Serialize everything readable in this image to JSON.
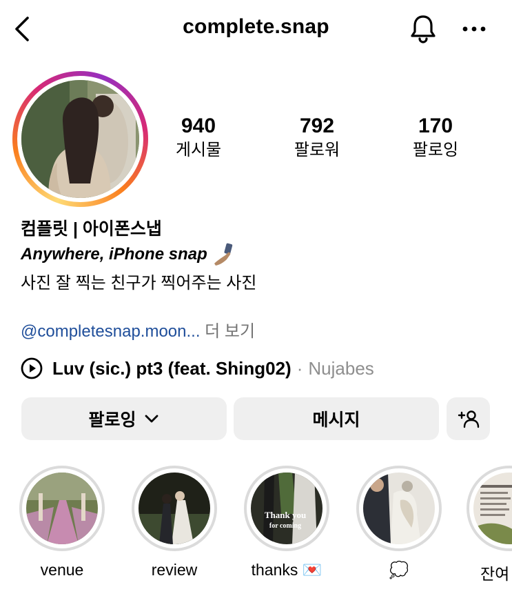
{
  "header": {
    "title": "complete.snap"
  },
  "stats": [
    {
      "value": "940",
      "label": "게시물"
    },
    {
      "value": "792",
      "label": "팔로워"
    },
    {
      "value": "170",
      "label": "팔로잉"
    }
  ],
  "bio": {
    "name": "컴플릿 | 아이폰스냅",
    "line1": "Anywhere, iPhone snap",
    "line2": "사진 잘 찍는 친구가 찍어주는 사진",
    "link": "@completesnap.moon...",
    "more": " 더 보기"
  },
  "music": {
    "song": "Luv (sic.) pt3 (feat. Shing02)",
    "separator": "·",
    "artist": "Nujabes"
  },
  "buttons": {
    "follow": "팔로잉",
    "message": "메시지"
  },
  "highlights": [
    {
      "label": "venue"
    },
    {
      "label": "review"
    },
    {
      "label": "thanks 💌",
      "card_title": "Thank you",
      "card_subtitle": "for coming"
    },
    {
      "label": "💭"
    },
    {
      "label": "잔여"
    }
  ],
  "icons": {
    "back": "chevron-left-icon",
    "bell": "bell-icon",
    "more": "more-horizontal-icon",
    "play": "play-circle-icon",
    "chevron": "chevron-down-icon",
    "add_user": "add-user-icon",
    "selfie_hand": "selfie-hand-icon"
  },
  "colors": {
    "link": "#1f4e9a",
    "muted": "#8e8e8e",
    "button_bg": "#efefef",
    "highlight_ring": "#dbdbdb"
  }
}
